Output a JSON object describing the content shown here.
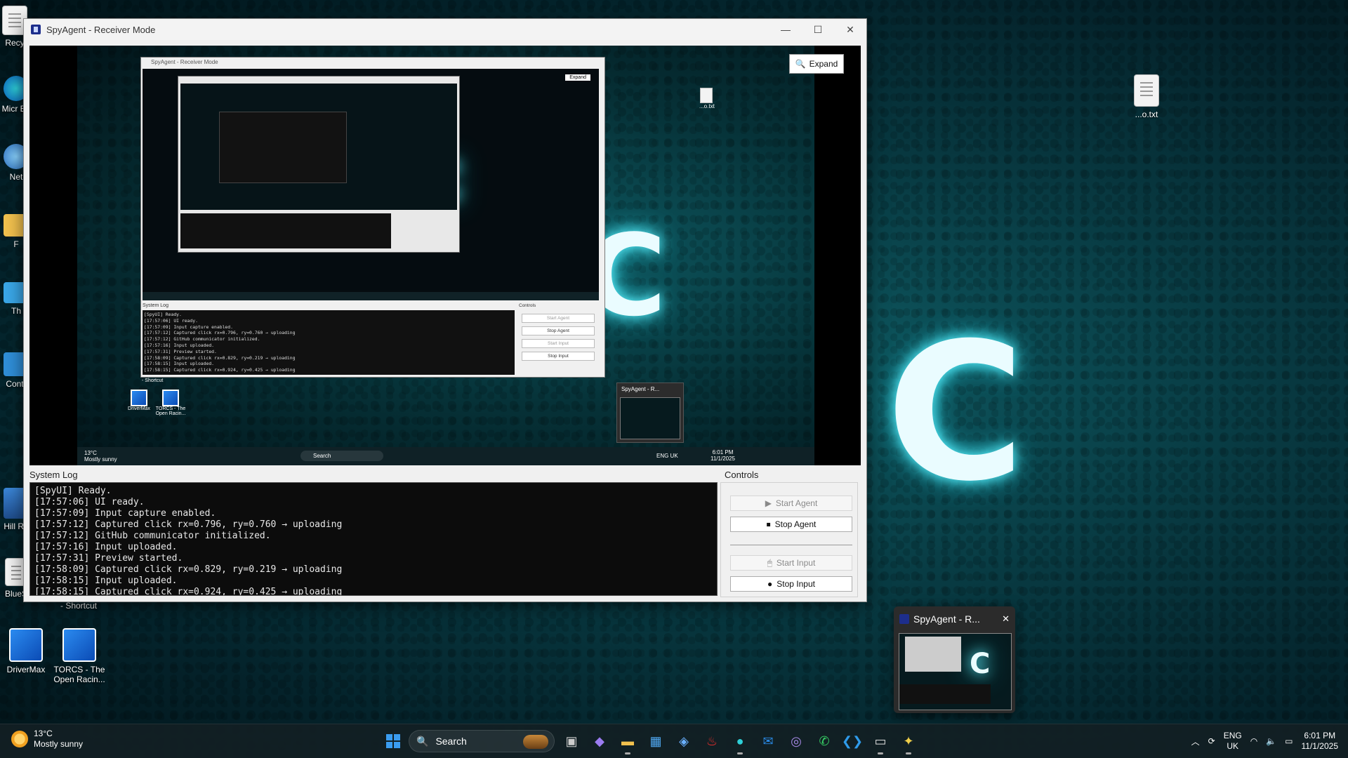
{
  "desktop": {
    "icons_left": [
      {
        "label": "Recy"
      },
      {
        "label": "Micr Ed"
      },
      {
        "label": "Net"
      },
      {
        "label": "F"
      },
      {
        "label": "Th"
      },
      {
        "label": "Contr"
      },
      {
        "label": "Hill Ra"
      },
      {
        "label": "BlueS"
      }
    ],
    "shortcut_caption": "- Shortcut",
    "bottom_icons": [
      {
        "label": "DriverMax"
      },
      {
        "label": "TORCS - The Open Racin..."
      }
    ],
    "right_icon": {
      "label": "...o.txt"
    },
    "wallpaper_letters": [
      "C",
      "C",
      "C"
    ]
  },
  "window": {
    "title": "SpyAgent - Receiver Mode",
    "controls": {
      "minimize": "—",
      "maximize": "☐",
      "close": "✕"
    },
    "expand_label": "Expand",
    "system_log_label": "System Log",
    "controls_label": "Controls",
    "log_lines": [
      "[SpyUI] Ready.",
      "[17:57:06] UI ready.",
      "[17:57:09] Input capture enabled.",
      "[17:57:12] Captured click rx=0.796, ry=0.760 → uploading",
      "[17:57:12] GitHub communicator initialized.",
      "[17:57:16] Input uploaded.",
      "[17:57:31] Preview started.",
      "[17:58:09] Captured click rx=0.829, ry=0.219 → uploading",
      "[17:58:15] Input uploaded.",
      "[17:58:15] Captured click rx=0.924, ry=0.425 → uploading"
    ],
    "buttons": {
      "start_agent": "Start Agent",
      "stop_agent": "Stop Agent",
      "start_input": "Start Input",
      "stop_input": "Stop Input"
    },
    "preview": {
      "mini_title": "SpyAgent - Receiver Mode",
      "mini_expand": "Expand",
      "mini_log_label": "System Log",
      "mini_controls_label": "Controls",
      "mini_txt": "...o.txt",
      "mini_thumb_title": "SpyAgent - R...",
      "mini_weather_temp": "13°C",
      "mini_weather_desc": "Mostly sunny",
      "mini_search": "Search",
      "mini_lang": "ENG UK",
      "mini_time": "6:01 PM",
      "mini_date": "11/1/2025",
      "mini_shortcut": "- Shortcut",
      "mini_icons": [
        "DriverMax",
        "TORCS - The Open Racin..."
      ]
    }
  },
  "thumbnail_popup": {
    "title": "SpyAgent - R...",
    "close": "✕"
  },
  "taskbar": {
    "weather_temp": "13°C",
    "weather_desc": "Mostly sunny",
    "search_placeholder": "Search",
    "lang_top": "ENG",
    "lang_bottom": "UK",
    "time": "6:01 PM",
    "date": "11/1/2025",
    "apps": [
      "task-view-icon",
      "copilot-icon",
      "file-explorer-icon",
      "store-icon",
      "photos-icon",
      "santander-icon",
      "edge-icon",
      "outlook-icon",
      "bt-icon",
      "whatsapp-icon",
      "vscode-icon",
      "terminal-icon",
      "python-icon"
    ]
  }
}
